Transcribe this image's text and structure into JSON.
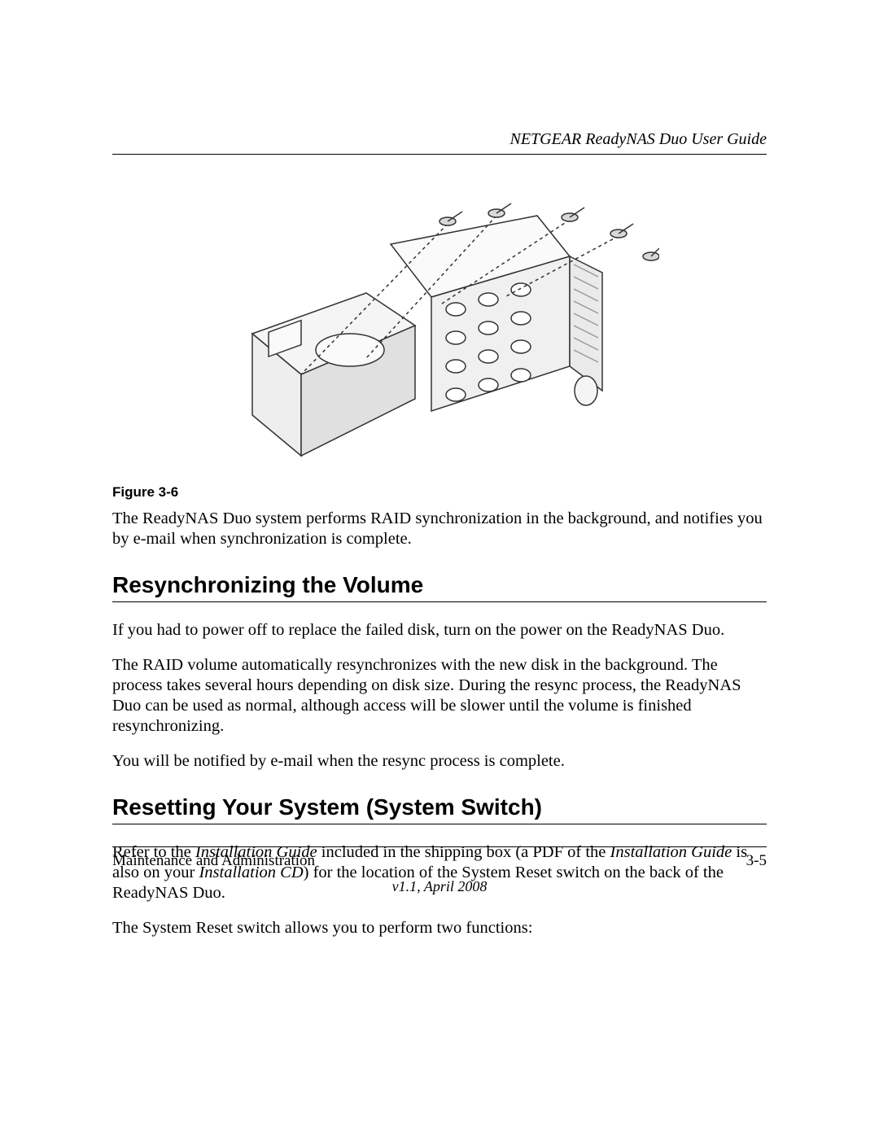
{
  "header": {
    "guide_title": "NETGEAR ReadyNAS Duo User Guide"
  },
  "figure": {
    "caption": "Figure 3-6"
  },
  "paragraphs": {
    "p1": "The ReadyNAS Duo system performs RAID synchronization in the background, and notifies you by e-mail when synchronization is complete.",
    "resync1": "If you had to power off to replace the failed disk, turn on the power on the ReadyNAS Duo.",
    "resync2": "The RAID volume automatically resynchronizes with the new disk in the background. The process takes several hours depending on disk size. During the resync process, the ReadyNAS Duo can be used as normal, although access will be slower until the volume is finished resynchronizing.",
    "resync3": "You will be notified by e-mail when the resync process is complete.",
    "reset1_a": "Refer to the ",
    "reset1_b": "Installation Guide",
    "reset1_c": " included in the shipping box (a PDF of the ",
    "reset1_d": "Installation Guide",
    "reset1_e": " is also on your ",
    "reset1_f": "Installation CD",
    "reset1_g": ") for the location of the System Reset switch on the back of the ReadyNAS Duo.",
    "reset2": "The System Reset switch allows you to perform two functions:"
  },
  "headings": {
    "resync": "Resynchronizing the Volume",
    "reset": "Resetting Your System (System Switch)"
  },
  "footer": {
    "section": "Maintenance and Administration",
    "page": "3-5",
    "version": "v1.1, April 2008"
  }
}
